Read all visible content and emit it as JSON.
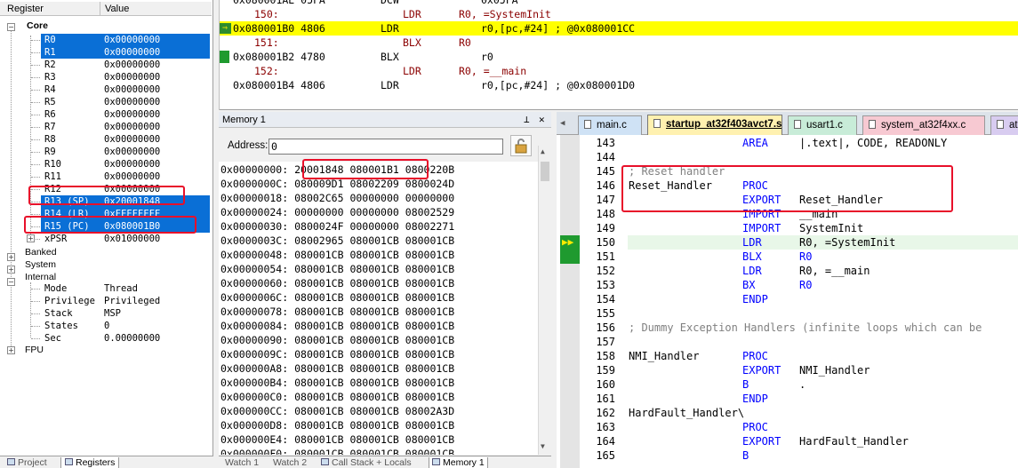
{
  "registers": {
    "header": {
      "name": "Register",
      "value": "Value"
    },
    "core_label": "Core",
    "core": [
      {
        "name": "R0",
        "value": "0x00000000",
        "selected": true
      },
      {
        "name": "R1",
        "value": "0x00000000",
        "selected": true
      },
      {
        "name": "R2",
        "value": "0x00000000",
        "selected": false
      },
      {
        "name": "R3",
        "value": "0x00000000",
        "selected": false
      },
      {
        "name": "R4",
        "value": "0x00000000",
        "selected": false
      },
      {
        "name": "R5",
        "value": "0x00000000",
        "selected": false
      },
      {
        "name": "R6",
        "value": "0x00000000",
        "selected": false
      },
      {
        "name": "R7",
        "value": "0x00000000",
        "selected": false
      },
      {
        "name": "R8",
        "value": "0x00000000",
        "selected": false
      },
      {
        "name": "R9",
        "value": "0x00000000",
        "selected": false
      },
      {
        "name": "R10",
        "value": "0x00000000",
        "selected": false
      },
      {
        "name": "R11",
        "value": "0x00000000",
        "selected": false
      },
      {
        "name": "R12",
        "value": "0x00000000",
        "selected": false
      },
      {
        "name": "R13 (SP)",
        "value": "0x20001848",
        "selected": true
      },
      {
        "name": "R14 (LR)",
        "value": "0xFFFFFFFF",
        "selected": true
      },
      {
        "name": "R15 (PC)",
        "value": "0x080001B0",
        "selected": true
      },
      {
        "name": "xPSR",
        "value": "0x01000000",
        "selected": false
      }
    ],
    "groups": [
      "Banked",
      "System",
      "Internal"
    ],
    "internal": [
      {
        "name": "Mode",
        "value": "Thread"
      },
      {
        "name": "Privilege",
        "value": "Privileged"
      },
      {
        "name": "Stack",
        "value": "MSP"
      },
      {
        "name": "States",
        "value": "0"
      },
      {
        "name": "Sec",
        "value": "0.00000000"
      }
    ],
    "fpu_label": "FPU",
    "tabs": [
      "Project",
      "Registers"
    ]
  },
  "disassembly": {
    "rows": [
      {
        "addr": "0x080001AE 05FA",
        "op": "DCW",
        "args": "0x05FA",
        "src": false
      },
      {
        "addr": "150:",
        "op": "LDR",
        "args": "R0, =SystemInit",
        "src": true
      },
      {
        "addr": "0x080001B0 4806",
        "op": "LDR",
        "args": "r0,[pc,#24]  ; @0x080001CC",
        "src": false,
        "current": true
      },
      {
        "addr": "151:",
        "op": "BLX",
        "args": "R0",
        "src": true
      },
      {
        "addr": "0x080001B2 4780",
        "op": "BLX",
        "args": "r0",
        "src": false
      },
      {
        "addr": "152:",
        "op": "LDR",
        "args": "R0, =__main",
        "src": true
      },
      {
        "addr": "0x080001B4 4806",
        "op": "LDR",
        "args": "r0,[pc,#24]  ; @0x080001D0",
        "src": false
      }
    ]
  },
  "memory": {
    "title": "Memory 1",
    "pin_icon": "pin-icon",
    "close_icon": "close-icon",
    "address_label": "Address:",
    "address_value": "0",
    "rows": [
      {
        "addr": "0x00000000:",
        "w1": "20001848",
        "w2": "080001B1",
        "w3": "0800220B"
      },
      {
        "addr": "0x0000000C:",
        "w1": "080009D1",
        "w2": "08002209",
        "w3": "0800024D"
      },
      {
        "addr": "0x00000018:",
        "w1": "08002C65",
        "w2": "00000000",
        "w3": "00000000"
      },
      {
        "addr": "0x00000024:",
        "w1": "00000000",
        "w2": "00000000",
        "w3": "08002529"
      },
      {
        "addr": "0x00000030:",
        "w1": "0800024F",
        "w2": "00000000",
        "w3": "08002271"
      },
      {
        "addr": "0x0000003C:",
        "w1": "08002965",
        "w2": "080001CB",
        "w3": "080001CB"
      },
      {
        "addr": "0x00000048:",
        "w1": "080001CB",
        "w2": "080001CB",
        "w3": "080001CB"
      },
      {
        "addr": "0x00000054:",
        "w1": "080001CB",
        "w2": "080001CB",
        "w3": "080001CB"
      },
      {
        "addr": "0x00000060:",
        "w1": "080001CB",
        "w2": "080001CB",
        "w3": "080001CB"
      },
      {
        "addr": "0x0000006C:",
        "w1": "080001CB",
        "w2": "080001CB",
        "w3": "080001CB"
      },
      {
        "addr": "0x00000078:",
        "w1": "080001CB",
        "w2": "080001CB",
        "w3": "080001CB"
      },
      {
        "addr": "0x00000084:",
        "w1": "080001CB",
        "w2": "080001CB",
        "w3": "080001CB"
      },
      {
        "addr": "0x00000090:",
        "w1": "080001CB",
        "w2": "080001CB",
        "w3": "080001CB"
      },
      {
        "addr": "0x0000009C:",
        "w1": "080001CB",
        "w2": "080001CB",
        "w3": "080001CB"
      },
      {
        "addr": "0x000000A8:",
        "w1": "080001CB",
        "w2": "080001CB",
        "w3": "080001CB"
      },
      {
        "addr": "0x000000B4:",
        "w1": "080001CB",
        "w2": "080001CB",
        "w3": "080001CB"
      },
      {
        "addr": "0x000000C0:",
        "w1": "080001CB",
        "w2": "080001CB",
        "w3": "080001CB"
      },
      {
        "addr": "0x000000CC:",
        "w1": "080001CB",
        "w2": "080001CB",
        "w3": "08002A3D"
      },
      {
        "addr": "0x000000D8:",
        "w1": "080001CB",
        "w2": "080001CB",
        "w3": "080001CB"
      },
      {
        "addr": "0x000000E4:",
        "w1": "080001CB",
        "w2": "080001CB",
        "w3": "080001CB"
      },
      {
        "addr": "0x000000F0:",
        "w1": "080001CB",
        "w2": "080001CB",
        "w3": "080001CB"
      }
    ],
    "bottom_tabs": [
      "Watch 1",
      "Watch 2",
      "Call Stack + Locals",
      "Memory 1"
    ]
  },
  "editor": {
    "tabs": [
      {
        "label": "main.c",
        "color": "#cfe2f5",
        "active": false
      },
      {
        "label": "startup_at32f403avct7.s",
        "color": "#fff1b0",
        "active": true
      },
      {
        "label": "usart1.c",
        "color": "#c8ecd8",
        "active": false
      },
      {
        "label": "system_at32f4xx.c",
        "color": "#f7c9d2",
        "active": false
      },
      {
        "label": "at3",
        "color": "#d8ccf0",
        "active": false
      }
    ],
    "lines": [
      {
        "n": "143",
        "label": "",
        "op": "AREA",
        "args": "|.text|, CODE, READONLY",
        "comment": ""
      },
      {
        "n": "144",
        "label": "",
        "op": "",
        "args": "",
        "comment": ""
      },
      {
        "n": "145",
        "label": "",
        "op": "",
        "args": "",
        "comment": "; Reset handler"
      },
      {
        "n": "146",
        "label": "Reset_Handler",
        "op": "PROC",
        "args": "",
        "comment": ""
      },
      {
        "n": "147",
        "label": "",
        "op": "EXPORT",
        "args": "Reset_Handler",
        "comment": ""
      },
      {
        "n": "148",
        "label": "",
        "op": "IMPORT",
        "args": "__main",
        "comment": ""
      },
      {
        "n": "149",
        "label": "",
        "op": "IMPORT",
        "args": "SystemInit",
        "comment": ""
      },
      {
        "n": "150",
        "label": "",
        "op": "LDR",
        "args": "R0, =SystemInit",
        "comment": "",
        "current": true
      },
      {
        "n": "151",
        "label": "",
        "op": "BLX",
        "args": "R0",
        "comment": ""
      },
      {
        "n": "152",
        "label": "",
        "op": "LDR",
        "args": "R0, =__main",
        "comment": ""
      },
      {
        "n": "153",
        "label": "",
        "op": "BX",
        "args": "R0",
        "comment": ""
      },
      {
        "n": "154",
        "label": "",
        "op": "ENDP",
        "args": "",
        "comment": ""
      },
      {
        "n": "155",
        "label": "",
        "op": "",
        "args": "",
        "comment": ""
      },
      {
        "n": "156",
        "label": "",
        "op": "",
        "args": "",
        "comment": "; Dummy Exception Handlers (infinite loops which can be"
      },
      {
        "n": "157",
        "label": "",
        "op": "",
        "args": "",
        "comment": ""
      },
      {
        "n": "158",
        "label": "NMI_Handler",
        "op": "PROC",
        "args": "",
        "comment": ""
      },
      {
        "n": "159",
        "label": "",
        "op": "EXPORT",
        "args": "NMI_Handler",
        "comment": ""
      },
      {
        "n": "160",
        "label": "",
        "op": "B",
        "args": ".",
        "comment": ""
      },
      {
        "n": "161",
        "label": "",
        "op": "ENDP",
        "args": "",
        "comment": ""
      },
      {
        "n": "162",
        "label": "HardFault_Handler\\",
        "op": "",
        "args": "",
        "comment": ""
      },
      {
        "n": "163",
        "label": "",
        "op": "PROC",
        "args": "",
        "comment": ""
      },
      {
        "n": "164",
        "label": "",
        "op": "EXPORT",
        "args": "HardFault_Handler",
        "comment": ""
      },
      {
        "n": "165",
        "label": "",
        "op": "B",
        "args": "",
        "comment": ""
      }
    ]
  },
  "colors": {
    "selection": "#0a6fd6",
    "current_line": "#ffff00",
    "annotation": "#e8102a",
    "keyword": "#0000ff",
    "comment": "#808080"
  }
}
